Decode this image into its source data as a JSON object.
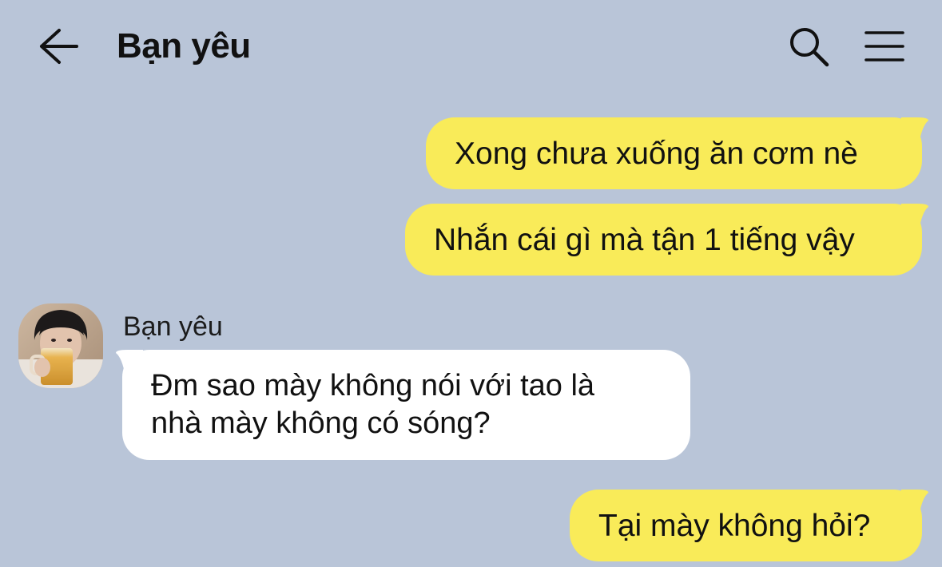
{
  "header": {
    "title": "Bạn yêu",
    "back_icon": "arrow-left-icon",
    "search_icon": "search-icon",
    "menu_icon": "hamburger-menu-icon"
  },
  "colors": {
    "background": "#b9c5d8",
    "my_bubble": "#f9eb59",
    "their_bubble": "#ffffff"
  },
  "messages": [
    {
      "sender": "me",
      "text": "Xong chưa xuống ăn cơm nè"
    },
    {
      "sender": "me",
      "text": "Nhắn cái gì mà tận 1 tiếng vậy"
    },
    {
      "sender": "Bạn yêu",
      "lines": [
        "Đm sao mày không nói với tao là",
        "nhà mày không có sóng?"
      ]
    },
    {
      "sender": "me",
      "text": "Tại mày không hỏi?"
    }
  ]
}
